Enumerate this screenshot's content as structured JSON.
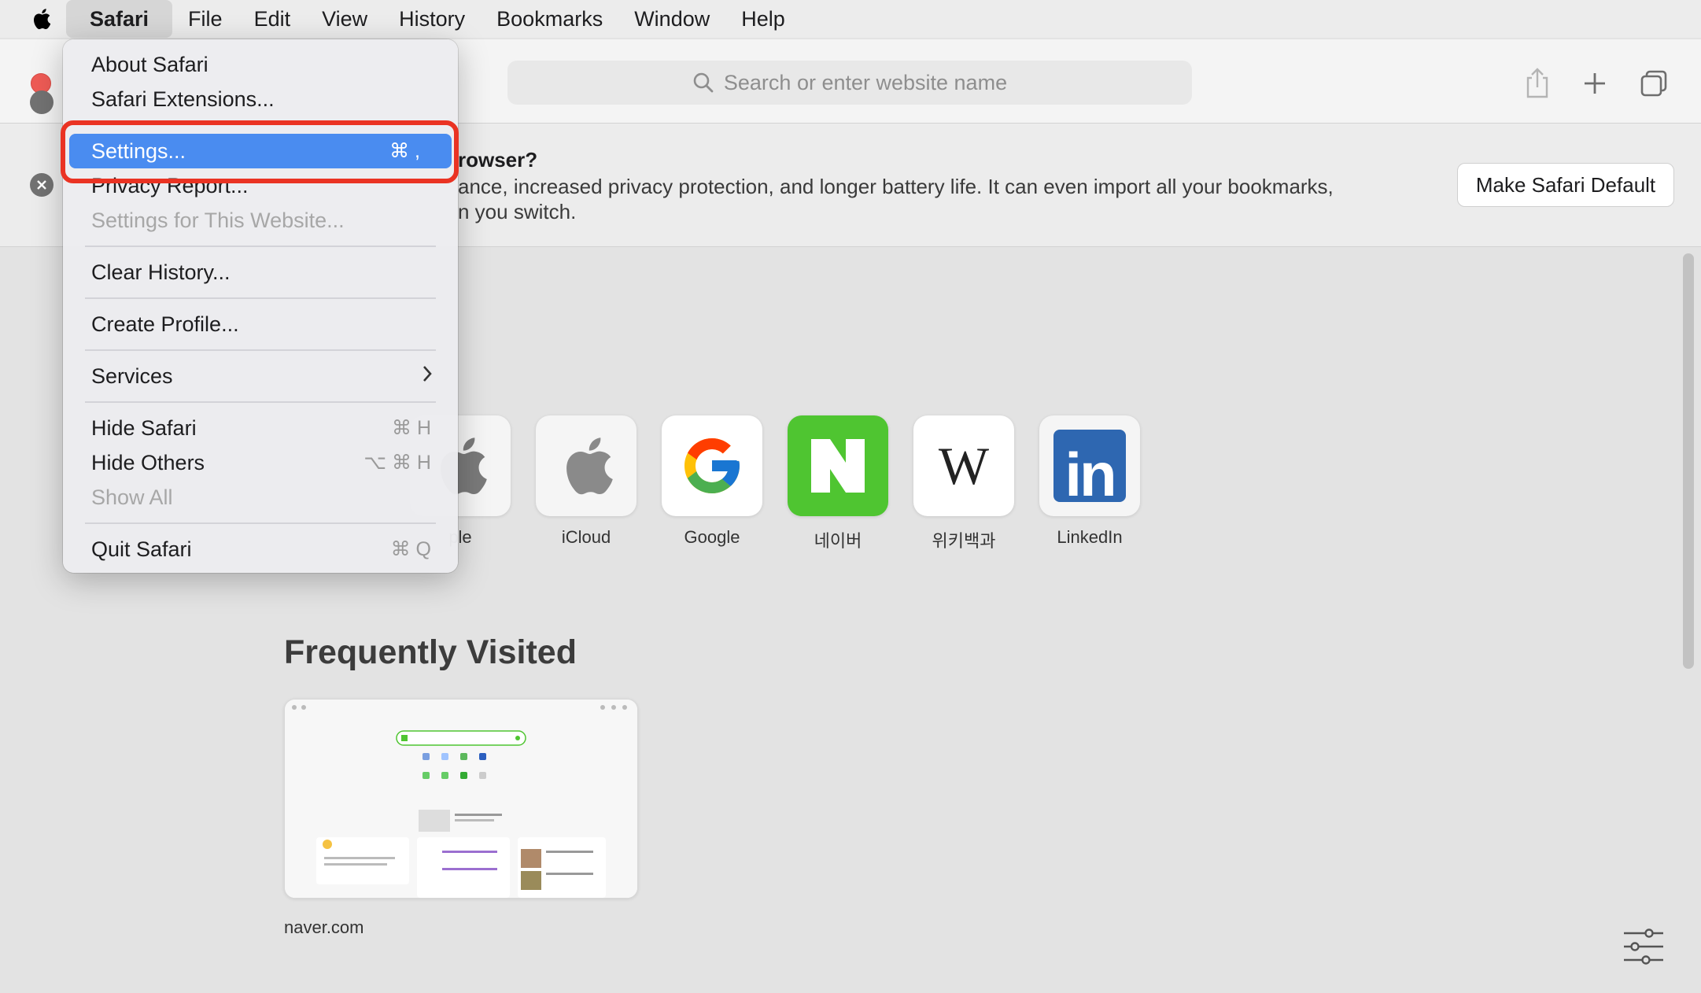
{
  "menubar": {
    "items": [
      "Safari",
      "File",
      "Edit",
      "View",
      "History",
      "Bookmarks",
      "Window",
      "Help"
    ]
  },
  "toolbar": {
    "search_placeholder": "Search or enter website name"
  },
  "banner": {
    "title": "rowser?",
    "line1": "ance, increased privacy protection, and longer battery life. It can even import all your bookmarks,",
    "line2": "n you switch.",
    "button": "Make Safari Default"
  },
  "favorites": [
    {
      "label": "ple",
      "icon": "apple-logo-icon"
    },
    {
      "label": "iCloud",
      "icon": "apple-logo-icon"
    },
    {
      "label": "Google",
      "icon": "google-logo-icon"
    },
    {
      "label": "네이버",
      "icon": "naver-logo-icon"
    },
    {
      "label": "위키백과",
      "icon": "wikipedia-logo-icon"
    },
    {
      "label": "LinkedIn",
      "icon": "linkedin-logo-icon"
    }
  ],
  "frequently_visited": {
    "title": "Frequently Visited",
    "items": [
      {
        "label": "naver.com"
      }
    ]
  },
  "safari_menu": {
    "items": [
      {
        "label": "About Safari",
        "shortcut": ""
      },
      {
        "label": "Safari Extensions...",
        "shortcut": ""
      },
      {
        "label": "Settings...",
        "shortcut": "⌘ ,"
      },
      {
        "label": "Privacy Report...",
        "shortcut": ""
      },
      {
        "label": "Settings for This Website...",
        "shortcut": ""
      },
      {
        "label": "Clear History...",
        "shortcut": ""
      },
      {
        "label": "Create Profile...",
        "shortcut": ""
      },
      {
        "label": "Services",
        "shortcut": ""
      },
      {
        "label": "Hide Safari",
        "shortcut": "⌘ H"
      },
      {
        "label": "Hide Others",
        "shortcut": "⌥ ⌘ H"
      },
      {
        "label": "Show All",
        "shortcut": ""
      },
      {
        "label": "Quit Safari",
        "shortcut": "⌘ Q"
      }
    ]
  },
  "colors": {
    "highlight": "#4a8cf0",
    "annotation_box": "#ea3323",
    "naver_green": "#4fc531",
    "linkedin_blue": "#2e67b1"
  }
}
